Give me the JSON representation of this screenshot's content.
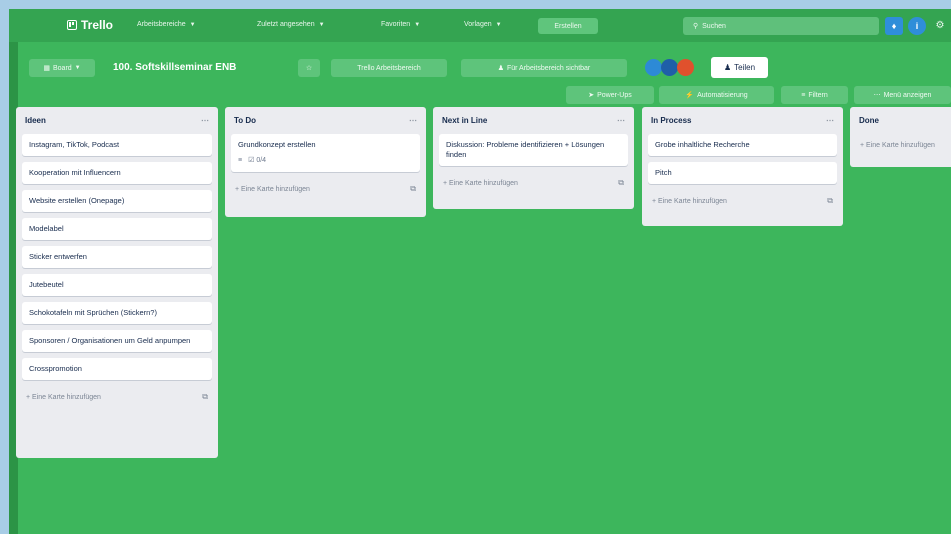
{
  "nav": {
    "logo": "Trello",
    "workspaces": "Arbeitsbereiche",
    "recent": "Zuletzt angesehen",
    "favorites": "Favoriten",
    "templates": "Vorlagen",
    "create": "Erstellen",
    "search_placeholder": "Suchen"
  },
  "board": {
    "view_button": "Board",
    "title": "100. Softskillseminar ENB",
    "workspace_button": "Trello Arbeitsbereich",
    "visibility_button": "Für Arbeitsbereich sichtbar",
    "share_button": "Teilen",
    "powerups_button": "Power-Ups",
    "automation_button": "Automatisierung",
    "filter_button": "Filtern",
    "menu_button": "Menü anzeigen",
    "avatars": [
      {
        "initials": "",
        "color": "#2d8ad6"
      },
      {
        "initials": "",
        "color": "#1f5fa8"
      },
      {
        "initials": "",
        "color": "#e0512d"
      }
    ]
  },
  "lists": [
    {
      "title": "Ideen",
      "cards": [
        {
          "text": "Instagram, TikTok, Podcast"
        },
        {
          "text": "Kooperation mit Influencern"
        },
        {
          "text": "Website erstellen (Onepage)"
        },
        {
          "text": "Modelabel"
        },
        {
          "text": "Sticker entwerfen"
        },
        {
          "text": "Jutebeutel"
        },
        {
          "text": "Schokotafeln mit Sprüchen (Stickern?)"
        },
        {
          "text": "Sponsoren / Organisationen um Geld anpumpen"
        },
        {
          "text": "Crosspromotion"
        }
      ],
      "add_label": "Eine Karte hinzufügen"
    },
    {
      "title": "To Do",
      "cards": [
        {
          "text": "Grundkonzept erstellen",
          "checklist": "0/4"
        }
      ],
      "add_label": "Eine Karte hinzufügen"
    },
    {
      "title": "Next in Line",
      "cards": [
        {
          "text": "Diskussion: Probleme identifizieren + Lösungen finden"
        }
      ],
      "add_label": "Eine Karte hinzufügen"
    },
    {
      "title": "In Process",
      "cards": [
        {
          "text": "Grobe inhaltliche Recherche"
        },
        {
          "text": "Pitch"
        }
      ],
      "add_label": "Eine Karte hinzufügen"
    },
    {
      "title": "Done",
      "cards": [],
      "add_label": "Eine Karte hinzufügen"
    }
  ],
  "colors": {
    "board_bg": "#3db65c",
    "nav_bg": "#34a451",
    "list_bg": "#ebecf0",
    "accent_blue": "#2f8ed9"
  }
}
